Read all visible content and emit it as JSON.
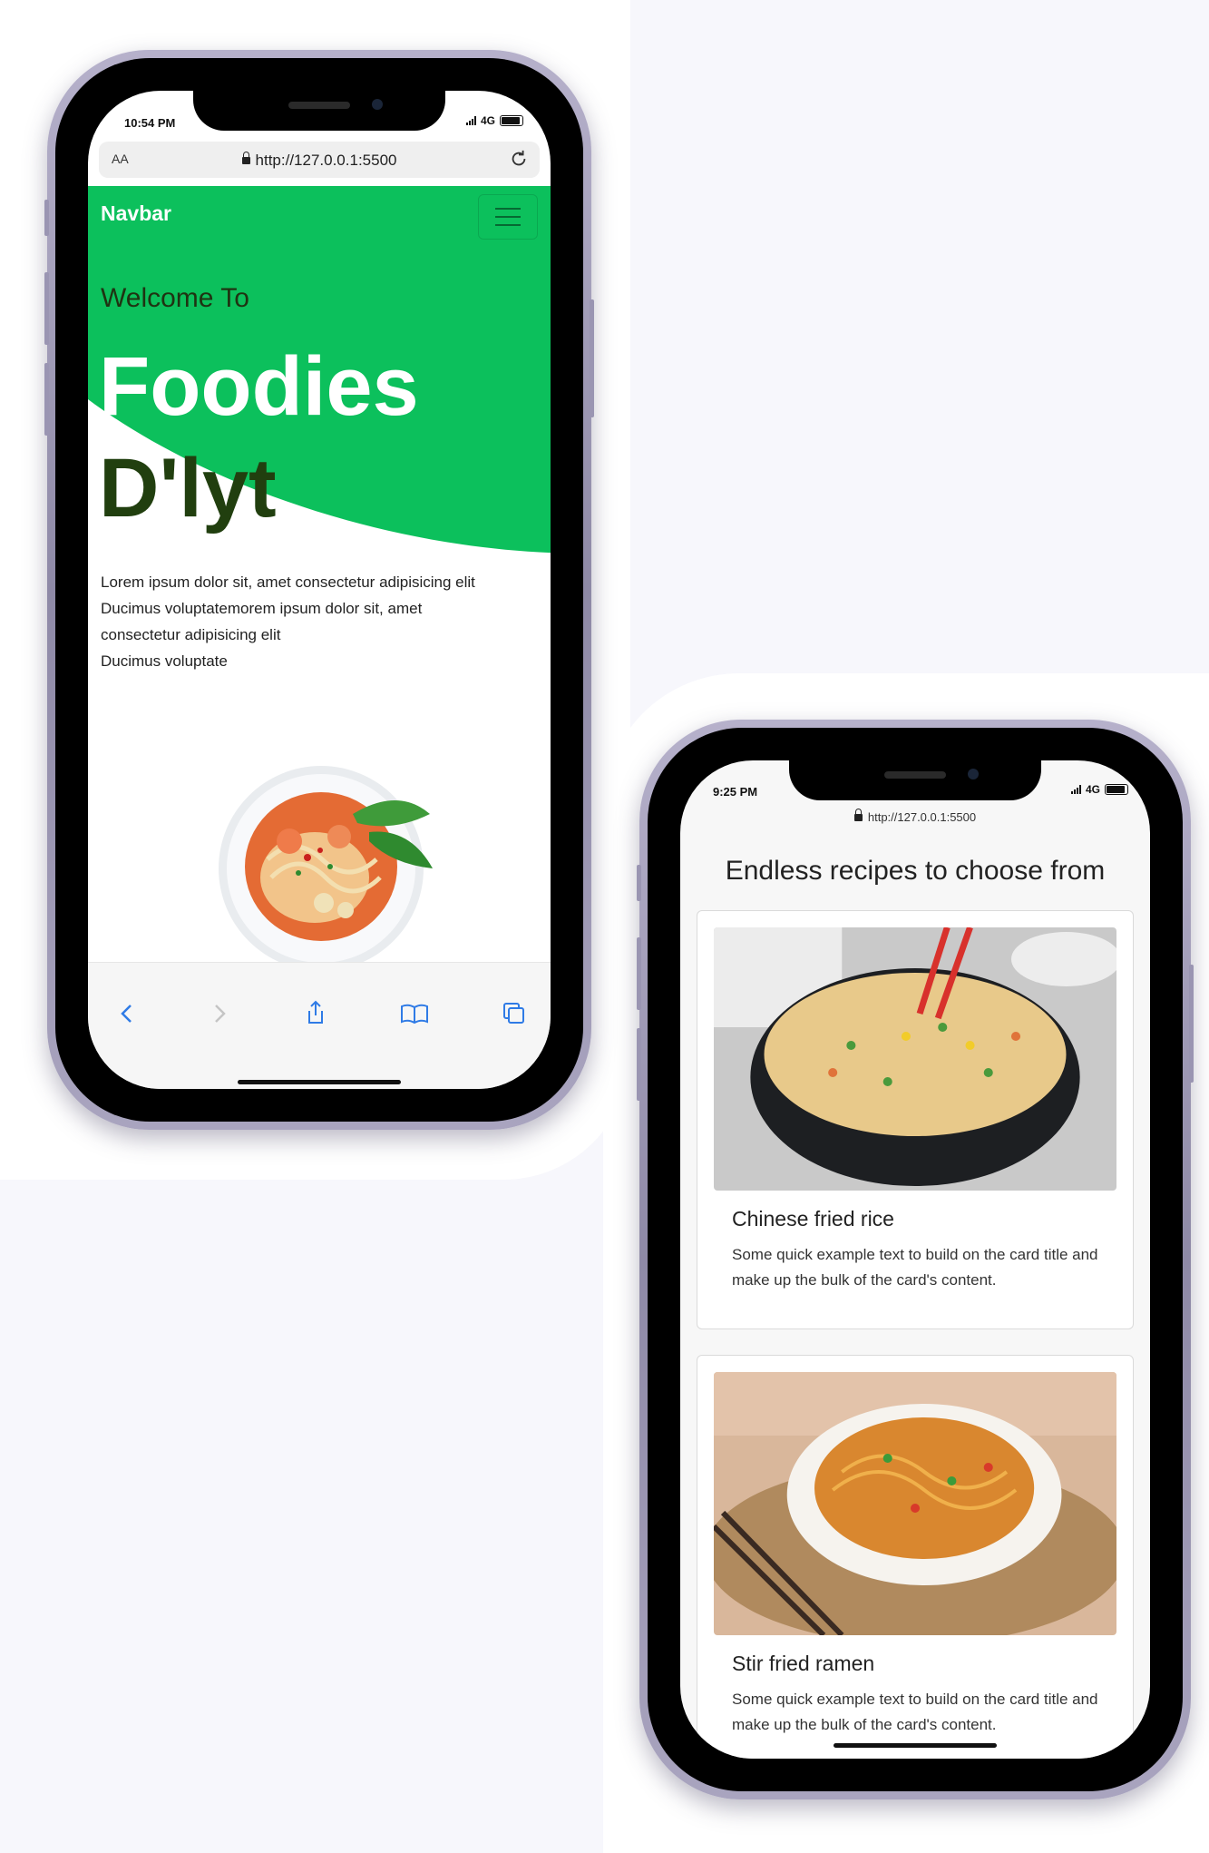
{
  "phone1": {
    "status": {
      "time": "10:54 PM",
      "network": "4G"
    },
    "browser": {
      "text_size_label": "AA",
      "url": "http://127.0.0.1:5500"
    },
    "navbar": {
      "brand": "Navbar"
    },
    "hero": {
      "welcome": "Welcome To",
      "title_line1": "Foodies",
      "title_line2": "D'lyt",
      "lorem_lines": [
        "Lorem ipsum dolor sit, amet consectetur adipisicing elit",
        "Ducimus voluptatemorem ipsum dolor sit, amet",
        "consectetur adipisicing elit",
        "Ducimus voluptate"
      ]
    },
    "toolbar": [
      "back-icon",
      "forward-icon",
      "share-icon",
      "bookmarks-icon",
      "tabs-icon"
    ]
  },
  "phone2": {
    "status": {
      "time": "9:25 PM",
      "network": "4G"
    },
    "browser": {
      "url": "http://127.0.0.1:5500"
    },
    "section_heading": "Endless recipes to choose from",
    "cards": [
      {
        "title": "Chinese fried rice",
        "text": "Some quick example text to build on the card title and make up the bulk of the card's content."
      },
      {
        "title": "Stir fried ramen",
        "text": "Some quick example text to build on the card title and make up the bulk of the card's content."
      }
    ]
  },
  "colors": {
    "hero_green": "#0cc05c",
    "dark_green": "#213f0f",
    "frame_lavender": "#a9a4bf",
    "ios_blue": "#2f7be6"
  }
}
